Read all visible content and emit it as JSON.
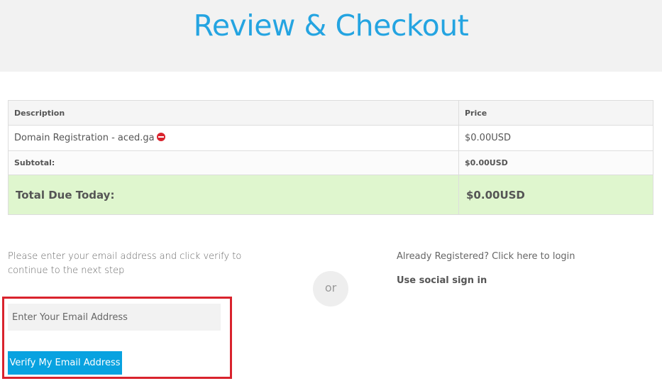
{
  "header": {
    "title": "Review & Checkout"
  },
  "cart": {
    "columns": {
      "description": "Description",
      "price": "Price"
    },
    "item": {
      "description": "Domain Registration - aced.ga",
      "price": "$0.00USD"
    },
    "subtotal": {
      "label": "Subtotal:",
      "value": "$0.00USD"
    },
    "total": {
      "label": "Total Due Today:",
      "value": "$0.00USD"
    }
  },
  "verify": {
    "instructions": "Please enter your email address and click verify to continue to the next step",
    "email_placeholder": "Enter Your Email Address",
    "email_value": "",
    "button_label": "Verify My Email Address"
  },
  "divider": {
    "label": "or"
  },
  "login": {
    "link_text": "Already Registered? Click here to login",
    "social_label": "Use social sign in"
  },
  "colors": {
    "accent": "#24a4e1",
    "button": "#08a2e0",
    "total_row": "#dff6ce",
    "highlight": "#d9232d"
  },
  "icons": {
    "remove": "remove-icon"
  }
}
